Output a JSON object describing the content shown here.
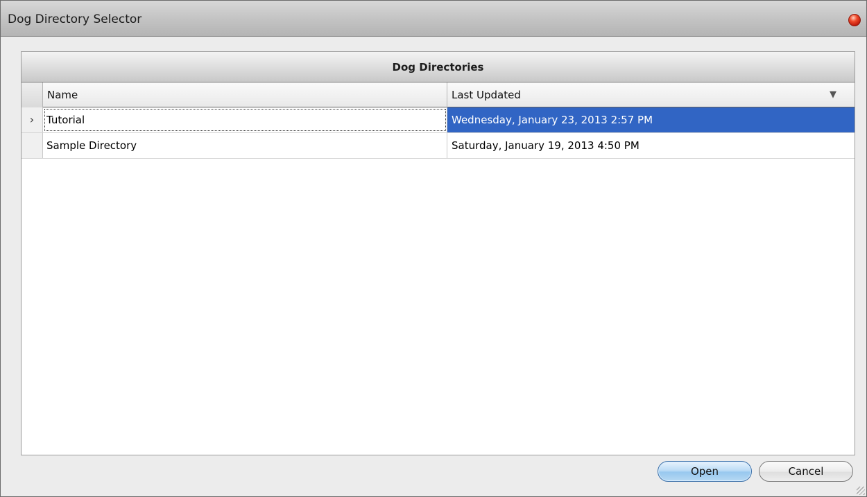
{
  "window": {
    "title": "Dog Directory Selector"
  },
  "grid": {
    "caption": "Dog Directories",
    "columns": {
      "name": "Name",
      "last_updated": "Last Updated"
    },
    "rows": [
      {
        "name": "Tutorial",
        "last_updated": "Wednesday, January 23, 2013 2:57 PM",
        "selected": true,
        "indicator": "›"
      },
      {
        "name": "Sample Directory",
        "last_updated": "Saturday, January 19, 2013 4:50 PM",
        "selected": false,
        "indicator": ""
      }
    ]
  },
  "buttons": {
    "open": "Open",
    "cancel": "Cancel"
  },
  "icons": {
    "close": "close-icon",
    "sort": "sort-descending-icon",
    "row_indicator": "row-indicator-icon",
    "resize": "resize-grip-icon"
  },
  "colors": {
    "selection": "#3165c4",
    "close": "#e0301a"
  }
}
